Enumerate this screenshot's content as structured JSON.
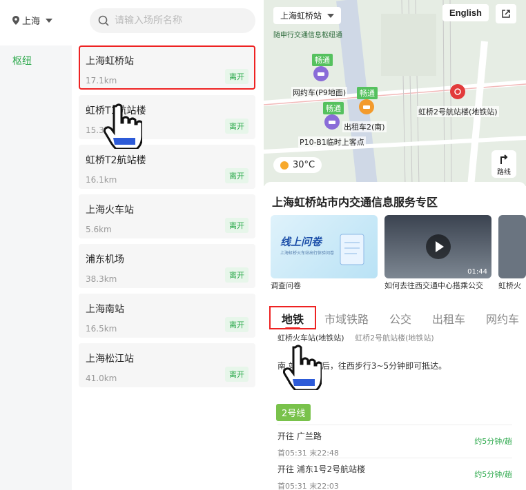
{
  "left": {
    "city": "上海",
    "search_placeholder": "请输入场所名称",
    "category": "枢纽",
    "leave_label": "离开",
    "hubs": [
      {
        "name": "上海虹桥站",
        "dist": "17.1km",
        "selected": true
      },
      {
        "name": "虹桥T1航站楼",
        "dist": "15.3km"
      },
      {
        "name": "虹桥T2航站楼",
        "dist": "16.1km"
      },
      {
        "name": "上海火车站",
        "dist": "5.6km"
      },
      {
        "name": "浦东机场",
        "dist": "38.3km"
      },
      {
        "name": "上海南站",
        "dist": "16.5km"
      },
      {
        "name": "上海松江站",
        "dist": "41.0km"
      }
    ]
  },
  "right": {
    "map": {
      "station": "上海虹桥站",
      "english": "English",
      "banner": "随申行交通信息枢纽通",
      "tag_1": "畅通",
      "tag_2": "畅通",
      "tag_3": "畅通",
      "label_ride": "网约车(P9地面)",
      "label_taxi": "出租车2(南)",
      "label_metro": "虹桥2号航站楼(地铁站)",
      "label_p10": "P10-B1临时上客点",
      "weather": "30°C",
      "route": "路线"
    },
    "title": "上海虹桥站市内交通信息服务专区",
    "cards": [
      {
        "caption": "调查问卷",
        "banner_title": "线上问卷",
        "banner_sub": "上海虹桥火车站出行体验问卷"
      },
      {
        "caption": "如何去往西交通中心搭乘公交",
        "duration": "01:44"
      },
      {
        "caption": "虹桥火"
      }
    ],
    "tabs": [
      "地铁",
      "市域铁路",
      "公交",
      "出租车",
      "网约车"
    ],
    "subtabs": [
      "虹桥火车站(地铁站)",
      "虹桥2号航站楼(地铁站)"
    ],
    "exit_desc": "南 站口出站后，往西步行3~5分钟即可抵达。",
    "line": "2号线",
    "directions": [
      {
        "to": "开往 广兰路",
        "times": "首05:31  末22:48",
        "freq": "约5分钟/趟"
      },
      {
        "to": "开往 浦东1号2号航站楼",
        "times": "首05:31  末22:03",
        "freq": "约5分钟/趟"
      }
    ]
  }
}
